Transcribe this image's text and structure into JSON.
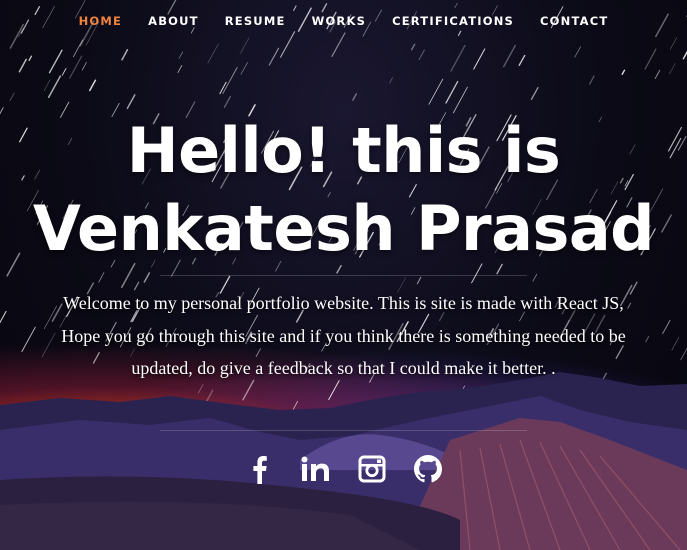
{
  "nav": {
    "items": [
      {
        "label": "HOME",
        "active": true
      },
      {
        "label": "ABOUT",
        "active": false
      },
      {
        "label": "RESUME",
        "active": false
      },
      {
        "label": "WORKS",
        "active": false
      },
      {
        "label": "CERTIFICATIONS",
        "active": false
      },
      {
        "label": "CONTACT",
        "active": false
      }
    ],
    "active_color": "#f0843f"
  },
  "hero": {
    "title_line1": "Hello! this is",
    "title_line2": "Venkatesh Prasad",
    "description": "Welcome to my personal portfolio website. This is site is made with React JS, Hope you go through this site and if you think there is something needed to be updated, do give a feedback so that I could make it better. ."
  },
  "social": [
    {
      "name": "facebook",
      "icon": "facebook-icon"
    },
    {
      "name": "linkedin",
      "icon": "linkedin-icon"
    },
    {
      "name": "instagram",
      "icon": "instagram-icon"
    },
    {
      "name": "github",
      "icon": "github-icon"
    }
  ]
}
